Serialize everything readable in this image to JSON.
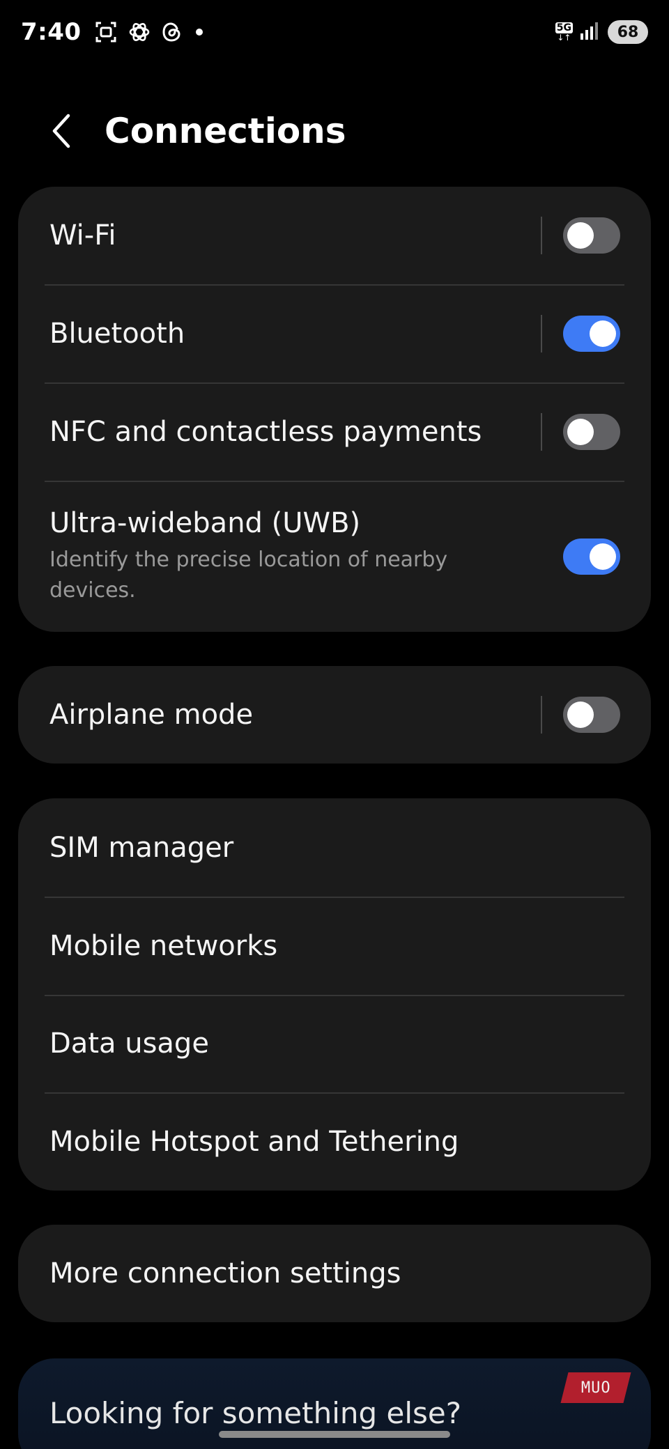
{
  "status_bar": {
    "time": "7:40",
    "network_label": "5G",
    "network_arrows": "↓↑",
    "battery": "68",
    "icons": [
      "screenshot-icon",
      "chatgpt-icon",
      "threads-icon",
      "notification-dot-icon",
      "signal-icon",
      "battery-icon"
    ]
  },
  "header": {
    "title": "Connections",
    "back_icon": "chevron-left-icon"
  },
  "groups": {
    "connectivity": {
      "wifi": {
        "label": "Wi-Fi",
        "toggle": "off"
      },
      "bluetooth": {
        "label": "Bluetooth",
        "toggle": "on"
      },
      "nfc": {
        "label": "NFC and contactless payments",
        "toggle": "off"
      },
      "uwb": {
        "label": "Ultra-wideband (UWB)",
        "description": "Identify the precise location of nearby devices.",
        "toggle": "on"
      }
    },
    "airplane": {
      "airplane_mode": {
        "label": "Airplane mode",
        "toggle": "off"
      }
    },
    "network": {
      "sim_manager": {
        "label": "SIM manager"
      },
      "mobile_networks": {
        "label": "Mobile networks"
      },
      "data_usage": {
        "label": "Data usage"
      },
      "hotspot": {
        "label": "Mobile Hotspot and Tethering"
      }
    },
    "more": {
      "more_settings": {
        "label": "More connection settings"
      }
    }
  },
  "banner": {
    "text": "Looking for something else?",
    "logo_text": "MUO"
  },
  "colors": {
    "background": "#000000",
    "card": "#1b1b1b",
    "toggle_on": "#3e7bf5",
    "toggle_off": "#616164",
    "divider": "#363636",
    "subtext": "#9a9a9a"
  }
}
